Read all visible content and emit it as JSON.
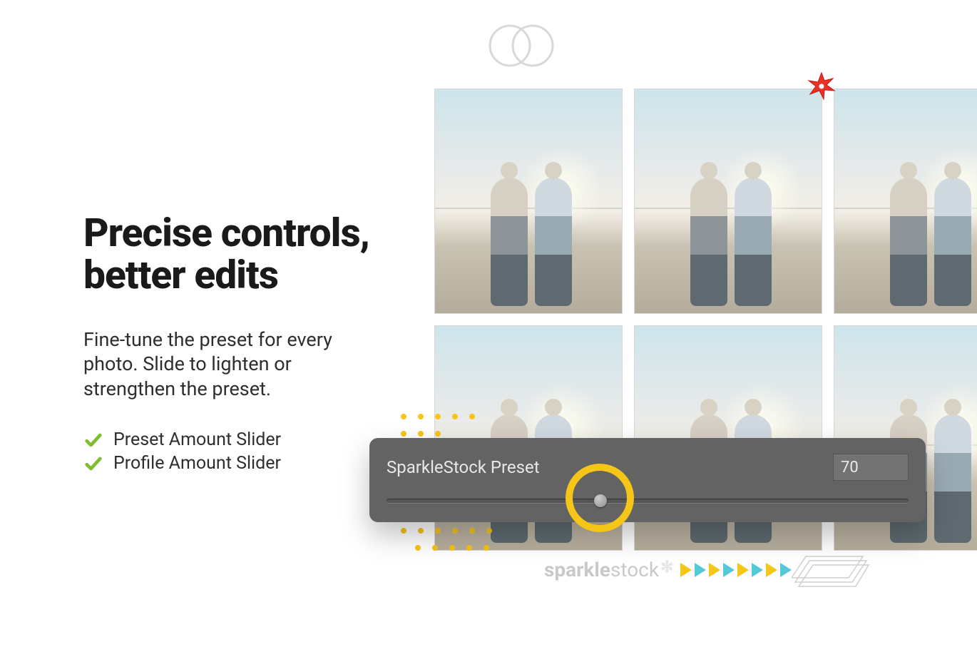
{
  "heading_line1": "Precise controls,",
  "heading_line2": "better edits",
  "subcopy": "Fine-tune the preset for every photo. Slide to lighten or strengthen the preset.",
  "features": {
    "0": "Preset Amount Slider",
    "1": "Profile Amount Slider"
  },
  "slider": {
    "label": "SparkleStock Preset",
    "value": "70",
    "percent": 41
  },
  "brand": {
    "part1": "sparkle",
    "part2": "stock"
  }
}
